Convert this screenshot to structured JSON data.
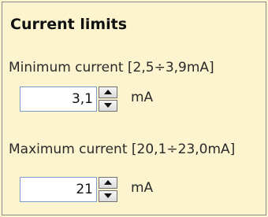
{
  "group": {
    "title": "Current limits"
  },
  "min_current": {
    "label": "Minimum current [2,5÷3,9mA]",
    "value": "3,1",
    "unit": "mA"
  },
  "max_current": {
    "label": "Maximum current [20,1÷23,0mA]",
    "value": "21",
    "unit": "mA"
  },
  "colors": {
    "panel_background": "#fbf4ce",
    "input_border": "#7a9cc8",
    "panel_border": "#8a8a8a"
  }
}
